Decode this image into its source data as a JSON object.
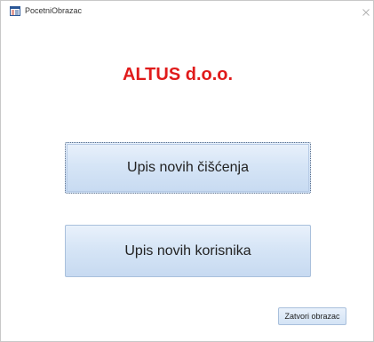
{
  "window": {
    "title": "PocetniObrazac",
    "icon": "form-icon"
  },
  "form": {
    "company_name": "ALTUS d.o.o.",
    "company_color": "#e01b1b",
    "button_new_cleanings": "Upis novih čišćenja",
    "button_new_users": "Upis novih korisnika",
    "button_close_form": "Zatvori obrazac"
  }
}
